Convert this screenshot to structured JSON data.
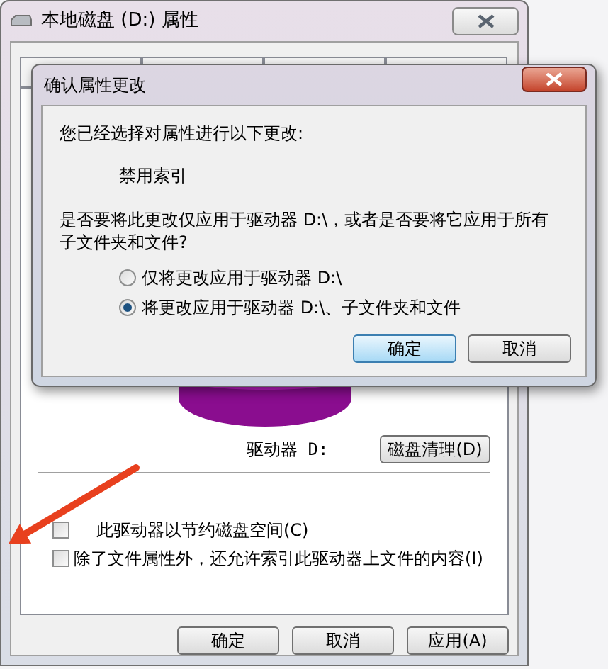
{
  "window": {
    "title": "本地磁盘 (D:) 属性"
  },
  "disk": {
    "label": "驱动器 D:",
    "cleanup_button": "磁盘清理(D)"
  },
  "options": [
    {
      "label": "此驱动器以节约磁盘空间(C)",
      "checked": false
    },
    {
      "label": "除了文件属性外，还允许索引此驱动器上文件的内容(I)",
      "checked": false
    }
  ],
  "buttons": [
    "确定",
    "取消",
    "应用(A)"
  ],
  "dialog": {
    "title": "确认属性更改",
    "intro": "您已经选择对属性进行以下更改:",
    "change": "禁用索引",
    "question": "是否要将此更改仅应用于驱动器 D:\\，或者是否要将它应用于所有子文件夹和文件?",
    "choices": [
      {
        "label": "仅将更改应用于驱动器 D:\\",
        "selected": false
      },
      {
        "label": "将更改应用于驱动器 D:\\、子文件夹和文件",
        "selected": true
      }
    ],
    "buttons": [
      {
        "label": "确定",
        "default": true
      },
      {
        "label": "取消",
        "default": false
      }
    ]
  }
}
